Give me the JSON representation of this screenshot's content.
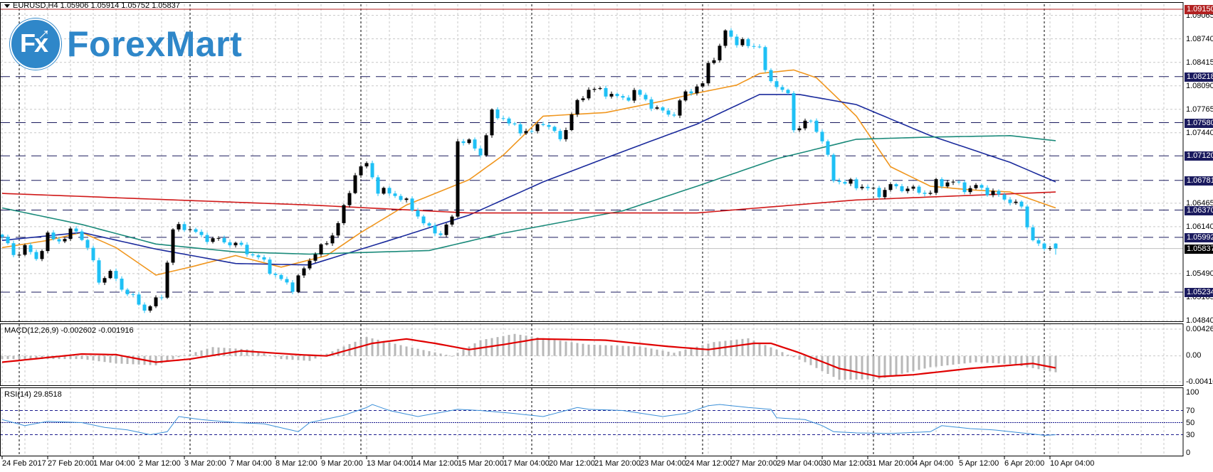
{
  "header": {
    "symbol": "EURUSD,H4",
    "open": "1.05906",
    "high": "1.05914",
    "low": "1.05752",
    "close": "1.05837"
  },
  "logo": {
    "text": "ForexMart",
    "mark": "Fx"
  },
  "colors": {
    "bear": "#1ec0f5",
    "bull": "#000000",
    "ma_orange": "#f0961e",
    "ma_navy": "#1a2a9c",
    "ma_teal": "#1a8a7a",
    "ma_red": "#d01818",
    "level_line": "#1a1a5e",
    "resistance": "#b22222",
    "macd_hist": "#b8b8b8",
    "macd_signal": "#e00000",
    "rsi": "#3a8fd8"
  },
  "chart_data": [
    {
      "type": "candlestick",
      "title": "EURUSD,H4",
      "ylim": [
        1.0484,
        1.0915
      ],
      "y_ticks": [
        "1.09065",
        "1.08740",
        "1.08415",
        "1.08090",
        "1.07765",
        "1.07440",
        "1.06465",
        "1.06140",
        "1.05490",
        "1.05165",
        "1.04840"
      ],
      "x_tick_labels": [
        "24 Feb 2017",
        "27 Feb 20:00",
        "1 Mar 04:00",
        "2 Mar 12:00",
        "3 Mar 20:00",
        "7 Mar 04:00",
        "8 Mar 12:00",
        "9 Mar 20:00",
        "13 Mar 04:00",
        "14 Mar 12:00",
        "15 Mar 20:00",
        "17 Mar 04:00",
        "20 Mar 12:00",
        "21 Mar 20:00",
        "23 Mar 04:00",
        "24 Mar 12:00",
        "27 Mar 20:00",
        "29 Mar 04:00",
        "30 Mar 12:00",
        "31 Mar 20:00",
        "4 Apr 04:00",
        "5 Apr 12:00",
        "6 Apr 20:00",
        "10 Apr 04:00"
      ],
      "bars": 186,
      "bars_per_x_tick": 8,
      "week_separator_bars": [
        3,
        33,
        63,
        93,
        123,
        153,
        183
      ],
      "close_keypoints": [
        [
          0,
          1.06
        ],
        [
          2,
          1.0575
        ],
        [
          4,
          1.0585
        ],
        [
          6,
          1.057
        ],
        [
          8,
          1.06
        ],
        [
          10,
          1.0595
        ],
        [
          13,
          1.061
        ],
        [
          15,
          1.0585
        ],
        [
          17,
          1.054
        ],
        [
          19,
          1.055
        ],
        [
          21,
          1.053
        ],
        [
          23,
          1.0515
        ],
        [
          25,
          1.05
        ],
        [
          27,
          1.051
        ],
        [
          28,
          1.052
        ],
        [
          30,
          1.061
        ],
        [
          32,
          1.0615
        ],
        [
          35,
          1.06
        ],
        [
          38,
          1.0595
        ],
        [
          41,
          1.059
        ],
        [
          43,
          1.058
        ],
        [
          46,
          1.0565
        ],
        [
          48,
          1.0545
        ],
        [
          51,
          1.053
        ],
        [
          53,
          1.0555
        ],
        [
          55,
          1.058
        ],
        [
          57,
          1.059
        ],
        [
          59,
          1.062
        ],
        [
          61,
          1.066
        ],
        [
          62,
          1.069
        ],
        [
          64,
          1.07
        ],
        [
          66,
          1.0665
        ],
        [
          68,
          1.066
        ],
        [
          70,
          1.0655
        ],
        [
          73,
          1.063
        ],
        [
          75,
          1.061
        ],
        [
          77,
          1.0605
        ],
        [
          79,
          1.0625
        ],
        [
          80,
          1.0735
        ],
        [
          82,
          1.073
        ],
        [
          84,
          1.0715
        ],
        [
          86,
          1.077
        ],
        [
          88,
          1.0765
        ],
        [
          90,
          1.075
        ],
        [
          93,
          1.0745
        ],
        [
          95,
          1.076
        ],
        [
          98,
          1.0735
        ],
        [
          101,
          1.0785
        ],
        [
          103,
          1.0805
        ],
        [
          106,
          1.08
        ],
        [
          109,
          1.079
        ],
        [
          111,
          1.08
        ],
        [
          113,
          1.079
        ],
        [
          115,
          1.0775
        ],
        [
          118,
          1.077
        ],
        [
          120,
          1.08
        ],
        [
          123,
          1.081
        ],
        [
          124,
          1.084
        ],
        [
          126,
          1.086
        ],
        [
          127,
          1.0885
        ],
        [
          129,
          1.087
        ],
        [
          131,
          1.0865
        ],
        [
          133,
          1.0865
        ],
        [
          134,
          1.0825
        ],
        [
          136,
          1.081
        ],
        [
          138,
          1.0795
        ],
        [
          139,
          1.075
        ],
        [
          142,
          1.076
        ],
        [
          144,
          1.0735
        ],
        [
          146,
          1.068
        ],
        [
          148,
          1.0675
        ],
        [
          151,
          1.067
        ],
        [
          154,
          1.066
        ],
        [
          156,
          1.067
        ],
        [
          160,
          1.0665
        ],
        [
          163,
          1.066
        ],
        [
          164,
          1.0675
        ],
        [
          167,
          1.0675
        ],
        [
          170,
          1.0665
        ],
        [
          171,
          1.067
        ],
        [
          174,
          1.066
        ],
        [
          177,
          1.065
        ],
        [
          179,
          1.064
        ],
        [
          181,
          1.0595
        ],
        [
          182,
          1.0588
        ],
        [
          183,
          1.0582
        ],
        [
          184,
          1.059
        ],
        [
          185,
          1.05837
        ]
      ],
      "last_bar": {
        "open": 1.05906,
        "high": 1.05914,
        "low": 1.05752,
        "close": 1.05837
      },
      "moving_averages": [
        {
          "name": "ma-orange",
          "color_key": "ma_orange",
          "points": [
            [
              0,
              1.0585
            ],
            [
              8,
              1.0595
            ],
            [
              14,
              1.0606
            ],
            [
              20,
              1.0585
            ],
            [
              27,
              1.0547
            ],
            [
              33,
              1.0558
            ],
            [
              41,
              1.0574
            ],
            [
              49,
              1.0558
            ],
            [
              57,
              1.0574
            ],
            [
              63,
              1.0606
            ],
            [
              71,
              1.0644
            ],
            [
              82,
              1.0679
            ],
            [
              88,
              1.0713
            ],
            [
              95,
              1.0767
            ],
            [
              106,
              1.0772
            ],
            [
              116,
              1.0788
            ],
            [
              122,
              1.0799
            ],
            [
              129,
              1.081
            ],
            [
              133,
              1.0826
            ],
            [
              139,
              1.0831
            ],
            [
              143,
              1.082
            ],
            [
              150,
              1.0767
            ],
            [
              156,
              1.0697
            ],
            [
              163,
              1.067
            ],
            [
              170,
              1.0665
            ],
            [
              177,
              1.0662
            ],
            [
              185,
              1.064
            ]
          ]
        },
        {
          "name": "ma-navy",
          "color_key": "ma_navy",
          "points": [
            [
              0,
              1.0595
            ],
            [
              14,
              1.0606
            ],
            [
              27,
              1.0583
            ],
            [
              41,
              1.0563
            ],
            [
              54,
              1.0561
            ],
            [
              68,
              1.0595
            ],
            [
              82,
              1.063
            ],
            [
              95,
              1.0676
            ],
            [
              109,
              1.0718
            ],
            [
              122,
              1.0756
            ],
            [
              133,
              1.0797
            ],
            [
              140,
              1.0797
            ],
            [
              150,
              1.0783
            ],
            [
              163,
              1.074
            ],
            [
              177,
              1.0703
            ],
            [
              185,
              1.0676
            ]
          ]
        },
        {
          "name": "ma-teal",
          "color_key": "ma_teal",
          "points": [
            [
              0,
              1.064
            ],
            [
              14,
              1.0617
            ],
            [
              27,
              1.059
            ],
            [
              41,
              1.0579
            ],
            [
              54,
              1.0576
            ],
            [
              75,
              1.0581
            ],
            [
              88,
              1.0605
            ],
            [
              109,
              1.0636
            ],
            [
              122,
              1.067
            ],
            [
              136,
              1.0708
            ],
            [
              150,
              1.0735
            ],
            [
              163,
              1.0738
            ],
            [
              177,
              1.074
            ],
            [
              185,
              1.0733
            ]
          ]
        },
        {
          "name": "ma-red",
          "color_key": "ma_red",
          "points": [
            [
              0,
              1.066
            ],
            [
              54,
              1.0644
            ],
            [
              82,
              1.0633
            ],
            [
              122,
              1.0633
            ],
            [
              150,
              1.0651
            ],
            [
              185,
              1.0662
            ]
          ]
        }
      ],
      "horizontal_levels": [
        {
          "value": "1.09150",
          "style": "resistance"
        },
        {
          "value": "1.08218",
          "style": "level"
        },
        {
          "value": "1.07580",
          "style": "level"
        },
        {
          "value": "1.07120",
          "style": "level"
        },
        {
          "value": "1.06781",
          "style": "level"
        },
        {
          "value": "1.06370",
          "style": "level"
        },
        {
          "value": "1.05992",
          "style": "level"
        },
        {
          "value": "1.05234",
          "style": "level"
        },
        {
          "value": "1.05837",
          "style": "current"
        }
      ]
    },
    {
      "type": "bar+line",
      "title": "MACD(12,26,9) -0.002602 -0.001916",
      "ylim": [
        -0.004108,
        0.004261
      ],
      "y_ticks": [
        "0.004261",
        "0.00",
        "-0.004108"
      ],
      "macd_keypoints": [
        [
          0,
          -0.0005
        ],
        [
          14,
          -0.0005
        ],
        [
          20,
          -0.0012
        ],
        [
          27,
          -0.0015
        ],
        [
          31,
          -0.0002
        ],
        [
          37,
          0.0014
        ],
        [
          44,
          0.001
        ],
        [
          49,
          -0.0005
        ],
        [
          54,
          -0.0008
        ],
        [
          60,
          0.0015
        ],
        [
          64,
          0.003
        ],
        [
          71,
          0.0015
        ],
        [
          79,
          0.0
        ],
        [
          84,
          0.0025
        ],
        [
          90,
          0.0035
        ],
        [
          95,
          0.0028
        ],
        [
          103,
          0.0018
        ],
        [
          112,
          0.0015
        ],
        [
          118,
          0.0005
        ],
        [
          125,
          0.0022
        ],
        [
          131,
          0.0028
        ],
        [
          136,
          0.001
        ],
        [
          141,
          -0.001
        ],
        [
          147,
          -0.0038
        ],
        [
          154,
          -0.0037
        ],
        [
          163,
          -0.0018
        ],
        [
          171,
          -0.001
        ],
        [
          177,
          -0.0013
        ],
        [
          185,
          -0.002602
        ]
      ],
      "signal_keypoints": [
        [
          0,
          -0.001
        ],
        [
          14,
          0.0003
        ],
        [
          20,
          0.0002
        ],
        [
          27,
          -0.001
        ],
        [
          33,
          -0.0005
        ],
        [
          42,
          0.0008
        ],
        [
          52,
          0.0002
        ],
        [
          57,
          0.0
        ],
        [
          65,
          0.002
        ],
        [
          71,
          0.0027
        ],
        [
          76,
          0.002
        ],
        [
          82,
          0.001
        ],
        [
          88,
          0.0018
        ],
        [
          94,
          0.0027
        ],
        [
          106,
          0.0025
        ],
        [
          117,
          0.0015
        ],
        [
          124,
          0.001
        ],
        [
          132,
          0.002
        ],
        [
          135,
          0.002
        ],
        [
          140,
          0.0005
        ],
        [
          147,
          -0.002
        ],
        [
          154,
          -0.0033
        ],
        [
          160,
          -0.003
        ],
        [
          170,
          -0.002
        ],
        [
          181,
          -0.0012
        ],
        [
          185,
          -0.001916
        ]
      ]
    },
    {
      "type": "line",
      "title": "RSI(14) 29.8518",
      "ylim": [
        0,
        100
      ],
      "y_ticks": [
        "100",
        "70",
        "50",
        "30",
        "0"
      ],
      "levels": [
        70,
        50,
        30
      ],
      "rsi_keypoints": [
        [
          0,
          55
        ],
        [
          4,
          45
        ],
        [
          8,
          52
        ],
        [
          14,
          50
        ],
        [
          18,
          42
        ],
        [
          22,
          38
        ],
        [
          26,
          30
        ],
        [
          29,
          35
        ],
        [
          31,
          60
        ],
        [
          35,
          55
        ],
        [
          41,
          50
        ],
        [
          46,
          48
        ],
        [
          52,
          35
        ],
        [
          54,
          50
        ],
        [
          60,
          62
        ],
        [
          64,
          75
        ],
        [
          65,
          80
        ],
        [
          68,
          70
        ],
        [
          73,
          60
        ],
        [
          80,
          72
        ],
        [
          84,
          70
        ],
        [
          90,
          65
        ],
        [
          95,
          60
        ],
        [
          101,
          75
        ],
        [
          103,
          72
        ],
        [
          109,
          70
        ],
        [
          116,
          60
        ],
        [
          120,
          65
        ],
        [
          124,
          78
        ],
        [
          126,
          80
        ],
        [
          131,
          75
        ],
        [
          135,
          72
        ],
        [
          136,
          58
        ],
        [
          141,
          55
        ],
        [
          144,
          45
        ],
        [
          146,
          35
        ],
        [
          150,
          33
        ],
        [
          156,
          32
        ],
        [
          163,
          35
        ],
        [
          165,
          45
        ],
        [
          170,
          40
        ],
        [
          174,
          38
        ],
        [
          180,
          32
        ],
        [
          183,
          29
        ],
        [
          185,
          29.8518
        ]
      ]
    }
  ]
}
